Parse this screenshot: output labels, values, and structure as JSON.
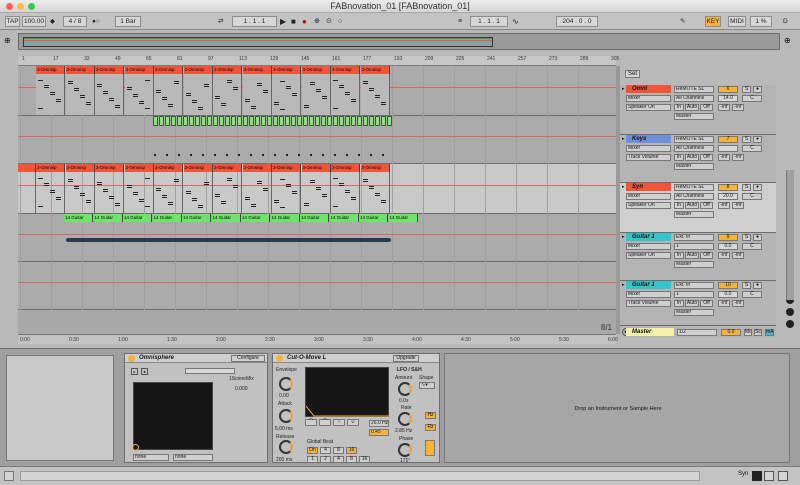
{
  "window": {
    "title": "FABnovation_01  [FABnovation_01]"
  },
  "control_bar": {
    "tap": "TAP",
    "tempo": "100.00",
    "meter": "4 / 8",
    "quantize": "1 Bar",
    "position": "1 .  1 .  1",
    "loop_start": "1 .  1 .  1",
    "loop_length": "204 .  0 .  0",
    "key": "KEY",
    "midi": "MIDI",
    "cpu": "1 %",
    "d_label": "D"
  },
  "ruler": {
    "ticks": [
      "1",
      "17",
      "33",
      "49",
      "65",
      "81",
      "97",
      "113",
      "129",
      "145",
      "161",
      "177",
      "193",
      "209",
      "225",
      "241",
      "257",
      "273",
      "289",
      "305"
    ],
    "time_ticks": [
      "0:00",
      "0:30",
      "1:00",
      "1:30",
      "2:00",
      "2:30",
      "3:00",
      "3:30",
      "4:00",
      "4:30",
      "5:00",
      "5:30",
      "6:00"
    ]
  },
  "set_label": "Set",
  "tracks": [
    {
      "name": "Omni",
      "color": "#f0553a",
      "clip_label": "3-Omnisp",
      "input": "ReMOTE SL",
      "channel": "All Channels",
      "mon1": "Mixer",
      "mon2": "Speaker On",
      "out": "Master",
      "num": "6",
      "val": "14.0",
      "pan": "C"
    },
    {
      "name": "Keys",
      "color": "#6f8fd9",
      "clip_label": "",
      "input": "ReMOTE SL",
      "channel": "All Channels",
      "mon1": "Mixer",
      "mon2": "Track Volume",
      "out": "Master",
      "num": "7",
      "val": "",
      "pan": "C"
    },
    {
      "name": "Syn",
      "color": "#f0553a",
      "clip_label": "3-Omnisp",
      "input": "ReMOTE SL",
      "channel": "All Channels",
      "mon1": "Mixer",
      "mon2": "Speaker On",
      "out": "Master",
      "num": "8",
      "val": "20.0",
      "pan": "C"
    },
    {
      "name": "Guitar 1",
      "color": "#36c3c9",
      "clip_label": "14 Guitar",
      "input": "Ext. In",
      "channel": "1",
      "mon1": "Mixer",
      "mon2": "Speaker On",
      "out": "Master",
      "num": "9",
      "val": "0.0",
      "pan": "C"
    },
    {
      "name": "Guitar 1",
      "color": "#36c3c9",
      "clip_label": "",
      "input": "Ext. In",
      "channel": "1",
      "mon1": "Mixer",
      "mon2": "Track Volume",
      "out": "Master",
      "num": "10",
      "val": "0.0",
      "pan": "C"
    }
  ],
  "master": {
    "name": "Master",
    "fraction": "8/1",
    "routing": "1/2",
    "val": "0.0",
    "mon_label": "mA",
    "icons": [
      "Mc",
      "Sc"
    ]
  },
  "monitor_buttons": {
    "in": "In",
    "auto": "Auto",
    "off": "Off",
    "inf": "-inf"
  },
  "devices": {
    "omnisphere": {
      "title": "Omnisphere",
      "configure": "Configure",
      "param": "1SceneMix",
      "value": "0.000",
      "sel1": "none",
      "sel2": "none"
    },
    "cutomove": {
      "title": "Cut-O-Move L",
      "upgrade": "Upgrade",
      "envelope": "Envelope",
      "attack_label": "Attack",
      "attack": "0.00",
      "release_label": "Release",
      "release": "5.00 ms",
      "decay_label": "Release",
      "decay": "200 ms",
      "lfo": "LFO / S&H",
      "amount": "Amount",
      "shape": "Shape",
      "rate_label": "Rate",
      "rate": "0.0s",
      "hz1": "26.0 Hz",
      "hz2": "0.45",
      "hz3": "2.85 Hz",
      "phase": "Phase",
      "phase_val": "171°",
      "global": "Global Beat",
      "on": "On",
      "bits": [
        "4",
        "8",
        "16",
        "1",
        "2",
        "4",
        "8",
        "16"
      ],
      "buttons": [
        "Hz",
        "Rz"
      ]
    },
    "empty": {
      "text": "Drop an Instrument or Sample Here"
    }
  },
  "status": {
    "right": "Syn"
  }
}
